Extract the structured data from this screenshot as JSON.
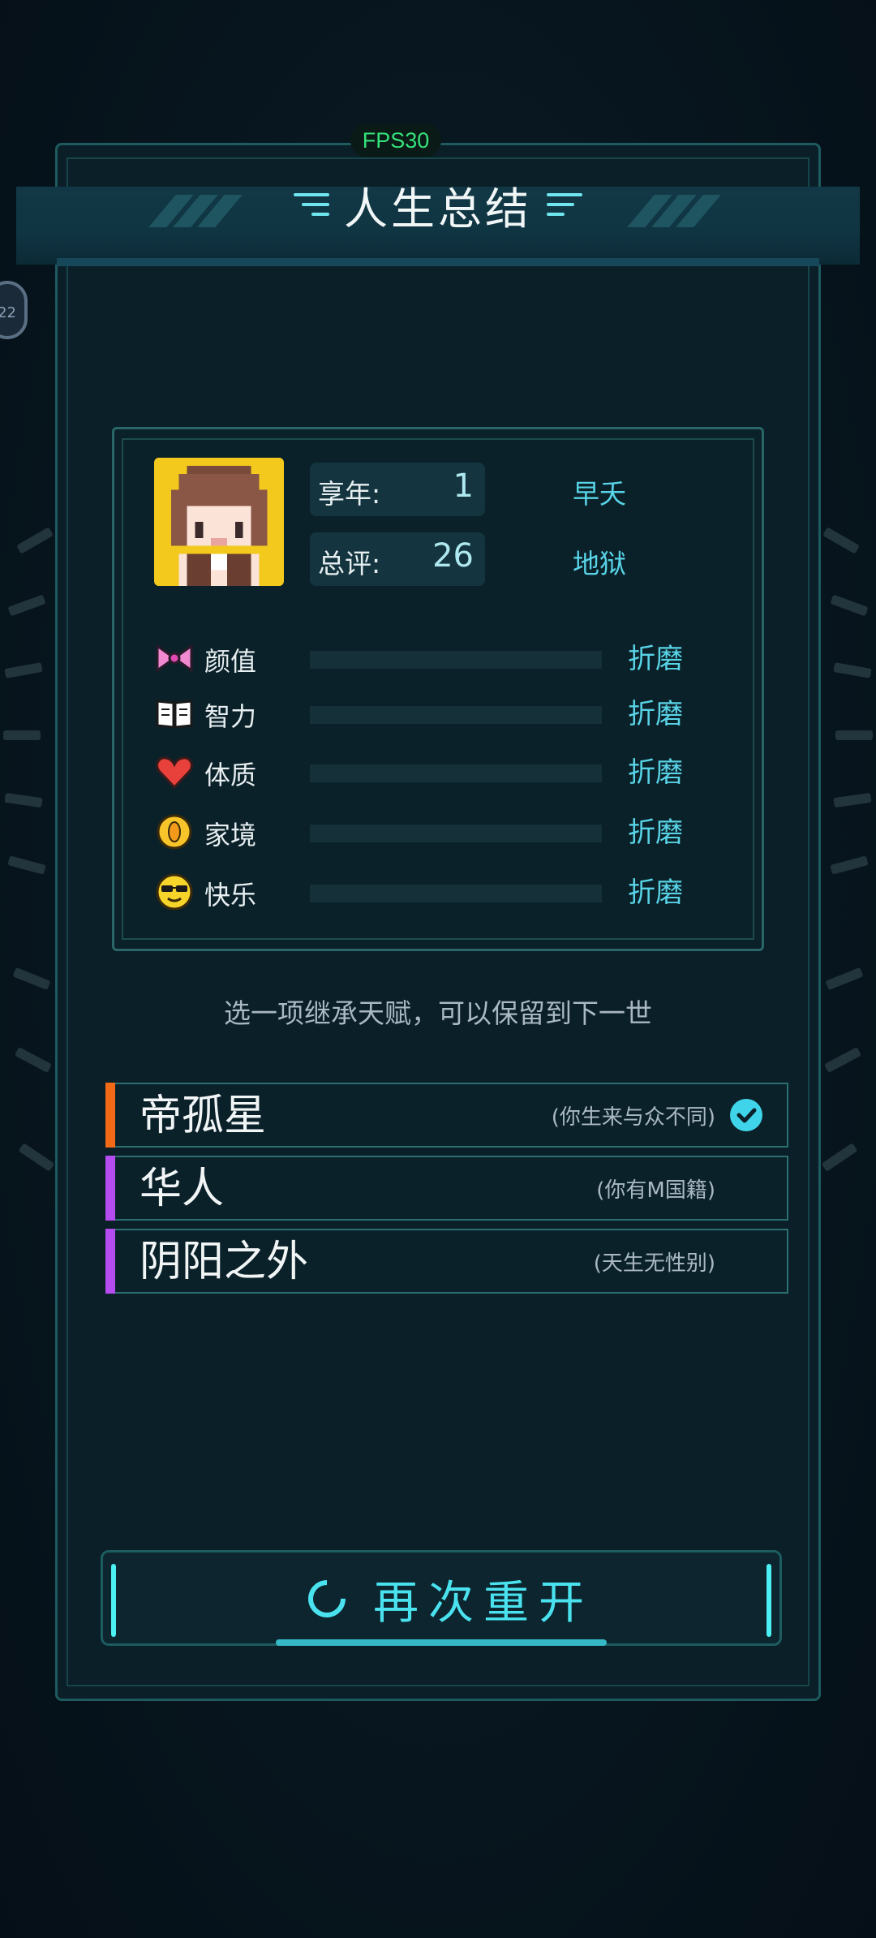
{
  "fps": "FPS30",
  "side_badge": "22",
  "title": "人生总结",
  "summary": {
    "age_label": "享年:",
    "age_value": "1",
    "age_verdict": "早夭",
    "score_label": "总评:",
    "score_value": "26",
    "score_verdict": "地狱"
  },
  "attributes": [
    {
      "label": "颜值",
      "icon": "bow-icon",
      "value": "折磨",
      "level": 0
    },
    {
      "label": "智力",
      "icon": "book-icon",
      "value": "折磨",
      "level": 0
    },
    {
      "label": "体质",
      "icon": "heart-icon",
      "value": "折磨",
      "level": 0
    },
    {
      "label": "家境",
      "icon": "coin-icon",
      "value": "折磨",
      "level": 0
    },
    {
      "label": "快乐",
      "icon": "sunglasses-face-icon",
      "value": "折磨",
      "level": 0
    }
  ],
  "hint": "选一项继承天赋，可以保留到下一世",
  "talents": [
    {
      "name": "帝孤星",
      "desc": "(你生来与众不同)",
      "selected": true,
      "color": "#f26a16"
    },
    {
      "name": "华人",
      "desc": "(你有M国籍)",
      "selected": false,
      "color": "#b44cf0"
    },
    {
      "name": "阴阳之外",
      "desc": "(天生无性别)",
      "selected": false,
      "color": "#b44cf0"
    }
  ],
  "restart_label": "再次重开",
  "colors": {
    "accent": "#4ae2ef",
    "verdict": "#58d3e6",
    "fps": "#34e27a"
  }
}
